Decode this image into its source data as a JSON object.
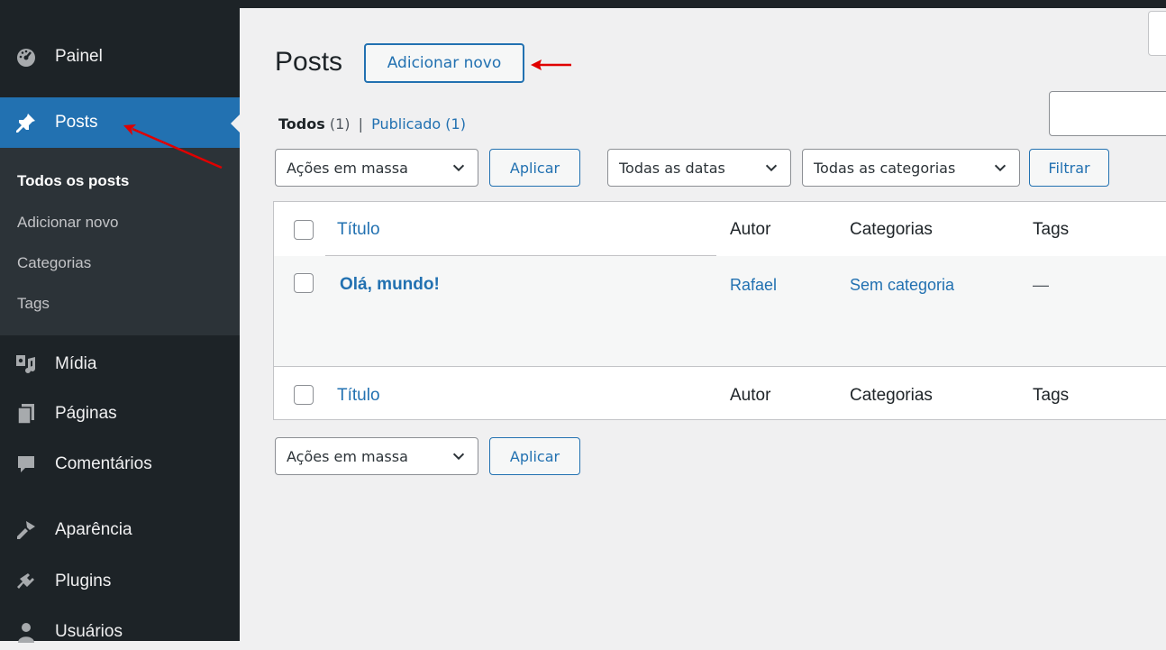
{
  "sidebar": {
    "items": [
      {
        "label": "Painel",
        "icon": "dashboard-icon"
      },
      {
        "label": "Posts",
        "icon": "pin-icon"
      },
      {
        "label": "Mídia",
        "icon": "media-icon"
      },
      {
        "label": "Páginas",
        "icon": "pages-icon"
      },
      {
        "label": "Comentários",
        "icon": "comments-icon"
      },
      {
        "label": "Aparência",
        "icon": "appearance-icon"
      },
      {
        "label": "Plugins",
        "icon": "plugins-icon"
      },
      {
        "label": "Usuários",
        "icon": "users-icon"
      }
    ],
    "submenu": [
      "Todos os posts",
      "Adicionar novo",
      "Categorias",
      "Tags"
    ]
  },
  "main": {
    "title": "Posts",
    "add_new": "Adicionar novo",
    "filters": {
      "all": "Todos",
      "all_count": "(1)",
      "sep": "|",
      "published": "Publicado",
      "published_count": "(1)"
    },
    "bulk_actions": "Ações em massa",
    "apply": "Aplicar",
    "dates": "Todas as datas",
    "categories": "Todas as categorias",
    "filter": "Filtrar"
  },
  "table": {
    "columns": [
      "Título",
      "Autor",
      "Categorias",
      "Tags"
    ],
    "rows": [
      {
        "title": "Olá, mundo!",
        "author": "Rafael",
        "categories": "Sem categoria",
        "tags": "—"
      }
    ]
  },
  "colors": {
    "sidebar_bg": "#1d2327",
    "accent": "#2271b1",
    "annotation": "#e00000"
  }
}
